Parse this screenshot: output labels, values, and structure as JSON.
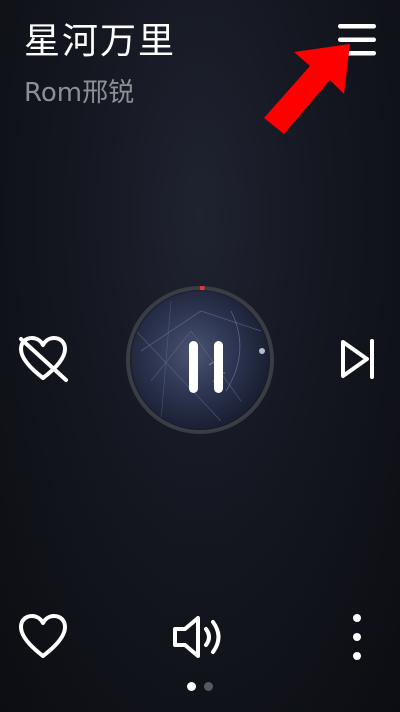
{
  "track": {
    "title": "星河万里",
    "artist": "Rom邢锐"
  },
  "controls": {
    "menu_icon": "menu-icon",
    "dislike_icon": "heart-off-icon",
    "play_state": "paused",
    "next_icon": "skip-next-icon",
    "like_icon": "heart-icon",
    "volume_icon": "volume-icon",
    "more_icon": "more-vertical-icon"
  },
  "progress": {
    "fraction": 0.01,
    "color": "#e53935",
    "track_color": "#3a3d45"
  },
  "pager": {
    "count": 2,
    "active_index": 0,
    "active_color": "#ffffff",
    "inactive_color": "#555962"
  },
  "annotation": {
    "arrow_color": "#ff0000",
    "points_to": "menu-button"
  }
}
